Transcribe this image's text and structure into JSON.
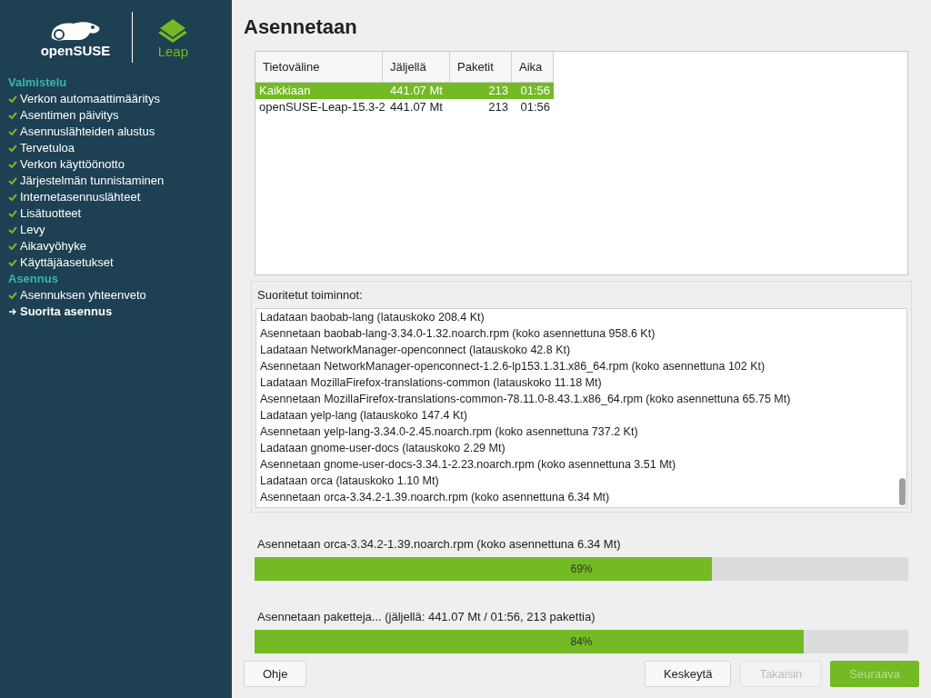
{
  "sidebar": {
    "logos": {
      "brand": "openSUSE",
      "product": "Leap"
    },
    "sections": [
      {
        "title": "Valmistelu",
        "items": [
          {
            "label": "Verkon automaattimääritys",
            "kind": "done",
            "selected": false
          },
          {
            "label": "Asentimen päivitys",
            "kind": "done",
            "selected": false
          },
          {
            "label": "Asennuslähteiden alustus",
            "kind": "done",
            "selected": false
          },
          {
            "label": "Tervetuloa",
            "kind": "done",
            "selected": false
          },
          {
            "label": "Verkon käyttöönotto",
            "kind": "done",
            "selected": false
          },
          {
            "label": "Järjestelmän tunnistaminen",
            "kind": "done",
            "selected": false
          },
          {
            "label": "Internetasennuslähteet",
            "kind": "done",
            "selected": false
          },
          {
            "label": "Lisätuotteet",
            "kind": "done",
            "selected": false
          },
          {
            "label": "Levy",
            "kind": "done",
            "selected": false
          },
          {
            "label": "Aikavyöhyke",
            "kind": "done",
            "selected": false
          },
          {
            "label": "Käyttäjäasetukset",
            "kind": "done",
            "selected": false
          }
        ]
      },
      {
        "title": "Asennus",
        "items": [
          {
            "label": "Asennuksen yhteenveto",
            "kind": "done",
            "selected": false
          },
          {
            "label": "Suorita asennus",
            "kind": "current",
            "selected": true
          }
        ]
      }
    ]
  },
  "title": "Asennetaan",
  "media_table": {
    "columns": [
      "Tietoväline",
      "Jäljellä",
      "Paketit",
      "Aika"
    ],
    "rows": [
      {
        "cells": [
          "Kaikkiaan",
          "441.07 Mt",
          "213",
          "01:56"
        ],
        "selected": true
      },
      {
        "cells": [
          "openSUSE-Leap-15.3-2",
          "441.07 Mt",
          "213",
          "01:56"
        ],
        "selected": false
      }
    ]
  },
  "log": {
    "label": "Suoritetut toiminnot:",
    "lines": [
      "Ladataan baobab-lang (latauskoko 208.4 Kt)",
      "Asennetaan baobab-lang-3.34.0-1.32.noarch.rpm (koko asennettuna 958.6 Kt)",
      "Ladataan NetworkManager-openconnect (latauskoko 42.8 Kt)",
      "Asennetaan NetworkManager-openconnect-1.2.6-lp153.1.31.x86_64.rpm (koko asennettuna 102 Kt)",
      "Ladataan MozillaFirefox-translations-common (latauskoko 11.18 Mt)",
      "Asennetaan MozillaFirefox-translations-common-78.11.0-8.43.1.x86_64.rpm (koko asennettuna 65.75 Mt)",
      "Ladataan yelp-lang (latauskoko 147.4 Kt)",
      "Asennetaan yelp-lang-3.34.0-2.45.noarch.rpm (koko asennettuna 737.2 Kt)",
      "Ladataan gnome-user-docs (latauskoko 2.29 Mt)",
      "Asennetaan gnome-user-docs-3.34.1-2.23.noarch.rpm (koko asennettuna 3.51 Mt)",
      "Ladataan orca (latauskoko 1.10 Mt)",
      "Asennetaan orca-3.34.2-1.39.noarch.rpm (koko asennettuna 6.34 Mt)"
    ]
  },
  "progress": [
    {
      "label": "Asennetaan orca-3.34.2-1.39.noarch.rpm (koko asennettuna 6.34 Mt)",
      "level": 0.7,
      "reading": "69%"
    },
    {
      "label": "Asennetaan paketteja... (jäljellä: 441.07 Mt / 01:56, 213 pakettia)",
      "level": 0.84,
      "reading": "84%"
    }
  ],
  "buttons": [
    {
      "label": "Ohje",
      "kind": "normal",
      "disabled": false
    },
    {
      "label": "Keskeytä",
      "kind": "normal",
      "disabled": false
    },
    {
      "label": "Takaisin",
      "kind": "normal",
      "disabled": true
    },
    {
      "label": "Seuraava",
      "kind": "primary",
      "disabled": true
    }
  ]
}
